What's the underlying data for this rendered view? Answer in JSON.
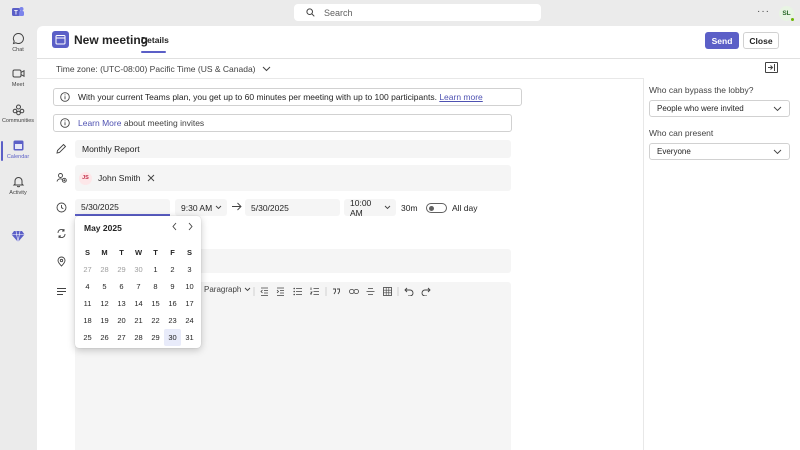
{
  "search": {
    "placeholder": "Search"
  },
  "topbar": {
    "more": "···",
    "avatar_initials": "SL"
  },
  "rail": [
    {
      "label": "Chat"
    },
    {
      "label": "Meet"
    },
    {
      "label": "Communities"
    },
    {
      "label": "Calendar"
    },
    {
      "label": "Activity"
    }
  ],
  "header": {
    "title": "New meeting",
    "tab": "Details",
    "send": "Send",
    "close": "Close"
  },
  "timezone": "Time zone: (UTC-08:00) Pacific Time (US & Canada)",
  "info": {
    "plan_text": "With your current Teams plan, you get up to 60 minutes per meeting with up to 100 participants.",
    "plan_link": "Learn more",
    "invite_link": "Learn More",
    "invite_text": "about meeting invites"
  },
  "meeting": {
    "title": "Monthly Report",
    "attendee": {
      "name": "John Smith",
      "initials": "JS"
    },
    "start_date": "5/30/2025",
    "start_time": "9:30 AM",
    "end_date": "5/30/2025",
    "end_time": "10:00 AM",
    "duration": "30m",
    "all_day": "All day"
  },
  "editor": {
    "paragraph": "Paragraph"
  },
  "right": {
    "lobby_label": "Who can bypass the lobby?",
    "lobby_value": "People who were invited",
    "present_label": "Who can present",
    "present_value": "Everyone"
  },
  "calendar": {
    "month": "May 2025",
    "weekdays": [
      "S",
      "M",
      "T",
      "W",
      "T",
      "F",
      "S"
    ],
    "weeks": [
      [
        "27",
        "28",
        "29",
        "30",
        "1",
        "2",
        "3"
      ],
      [
        "4",
        "5",
        "6",
        "7",
        "8",
        "9",
        "10"
      ],
      [
        "11",
        "12",
        "13",
        "14",
        "15",
        "16",
        "17"
      ],
      [
        "18",
        "19",
        "20",
        "21",
        "22",
        "23",
        "24"
      ],
      [
        "25",
        "26",
        "27",
        "28",
        "29",
        "30",
        "31"
      ]
    ],
    "selected": "30"
  },
  "colors": {
    "accent": "#5b5fc7",
    "link": "#4f52b2"
  }
}
